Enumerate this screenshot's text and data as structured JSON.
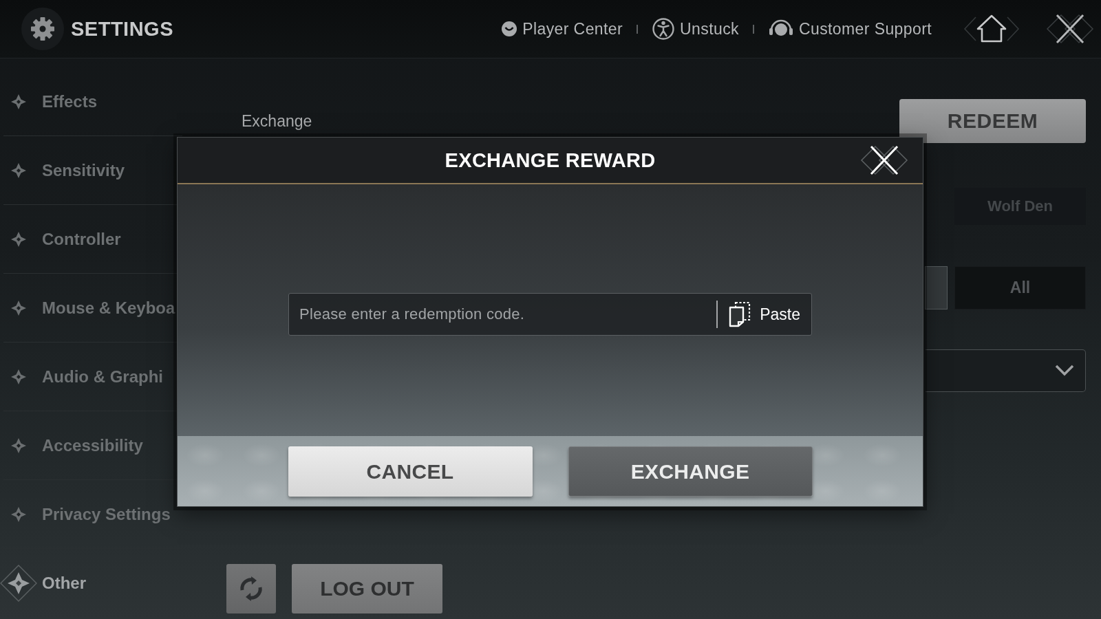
{
  "header": {
    "title": "SETTINGS",
    "links": [
      {
        "kind": "player",
        "label": "Player Center"
      },
      {
        "kind": "unstuck",
        "label": "Unstuck"
      },
      {
        "kind": "support",
        "label": "Customer Support"
      }
    ]
  },
  "sidebar": {
    "items": [
      {
        "label": "Effects",
        "selected": false
      },
      {
        "label": "Sensitivity",
        "selected": false
      },
      {
        "label": "Controller",
        "selected": false
      },
      {
        "label": "Mouse & Keyboa",
        "selected": false
      },
      {
        "label": "Audio & Graphi",
        "selected": false
      },
      {
        "label": "Accessibility",
        "selected": false
      },
      {
        "label": "Privacy Settings",
        "selected": false
      },
      {
        "label": "Other",
        "selected": true
      }
    ]
  },
  "content": {
    "exchange_label": "Exchange",
    "redeem_button": "REDEEM",
    "server_option": "Wolf Den",
    "filter_options": [
      {
        "selected": true
      },
      {
        "label": "All",
        "selected": false
      }
    ],
    "logout_button": "LOG OUT"
  },
  "dialog": {
    "title": "EXCHANGE REWARD",
    "code_field": {
      "placeholder": "Please enter a redemption code."
    },
    "paste_button": "Paste",
    "buttons": [
      {
        "kind": "cancel",
        "label": "CANCEL"
      },
      {
        "kind": "confirm",
        "label": "EXCHANGE"
      }
    ]
  }
}
